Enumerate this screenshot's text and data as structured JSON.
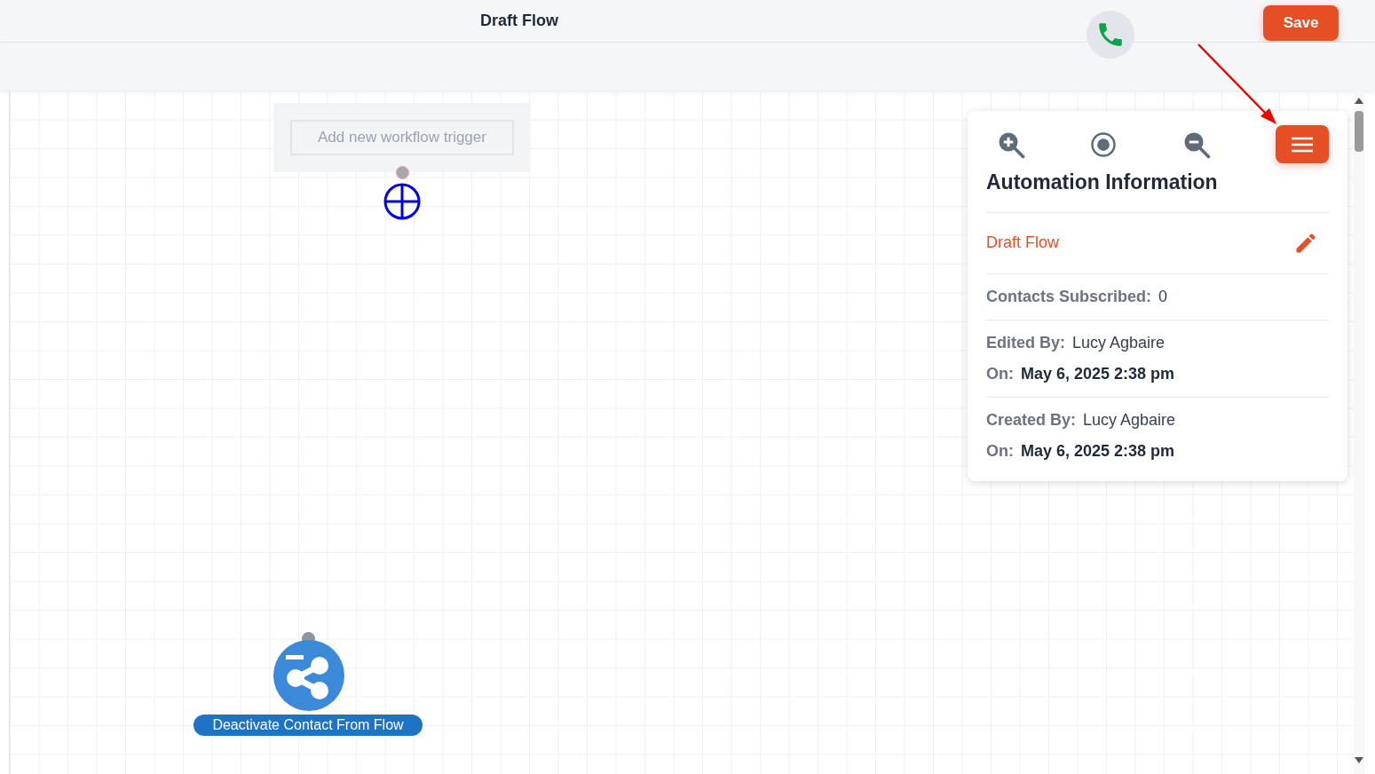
{
  "header": {
    "title": "Draft Flow",
    "save_button": "Save"
  },
  "canvas": {
    "trigger_button": "Add new workflow trigger",
    "action_node": {
      "label": "Deactivate Contact From Flow"
    }
  },
  "info_panel": {
    "title": "Automation Information",
    "flow_name": "Draft Flow",
    "contacts_subscribed": {
      "label": "Contacts Subscribed:",
      "value": "0"
    },
    "edited": {
      "by_label": "Edited By:",
      "by": "Lucy Agbaire",
      "on_label": "On:",
      "on": "May 6, 2025 2:38 pm"
    },
    "created": {
      "by_label": "Created By:",
      "by": "Lucy Agbaire",
      "on_label": "On:",
      "on": "May 6, 2025 2:38 pm"
    }
  }
}
